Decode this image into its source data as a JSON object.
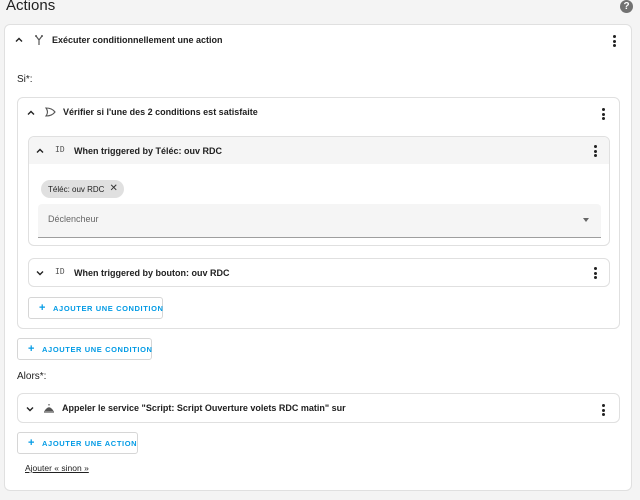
{
  "header": {
    "title": "Actions",
    "help_icon": "help-circle-icon"
  },
  "action": {
    "title": "Exécuter conditionnellement une action",
    "icon": "source-branch-icon",
    "if_label": "Si*:",
    "or_block": {
      "title": "Vérifier si l'une des 2 conditions est satisfaite",
      "icon": "logic-gate-or-icon",
      "conditions": [
        {
          "title": "When triggered by Téléc: ouv RDC",
          "icon": "identifier-icon",
          "expanded": true,
          "chip_label": "Téléc: ouv RDC",
          "select_placeholder": "Déclencheur"
        },
        {
          "title": "When triggered by bouton: ouv RDC",
          "icon": "identifier-icon",
          "expanded": false
        }
      ],
      "add_condition_label": "AJOUTER UNE CONDITION"
    },
    "add_condition_label": "AJOUTER UNE CONDITION",
    "then_label": "Alors*:",
    "service": {
      "title": "Appeler le service \"Script: Script Ouverture volets RDC matin\" sur",
      "icon": "room-service-icon"
    },
    "add_action_label": "AJOUTER UNE ACTION",
    "else_link": "Ajouter « sinon »"
  },
  "colors": {
    "accent": "#039be5",
    "background": "#f4f4f4",
    "card": "#ffffff"
  }
}
